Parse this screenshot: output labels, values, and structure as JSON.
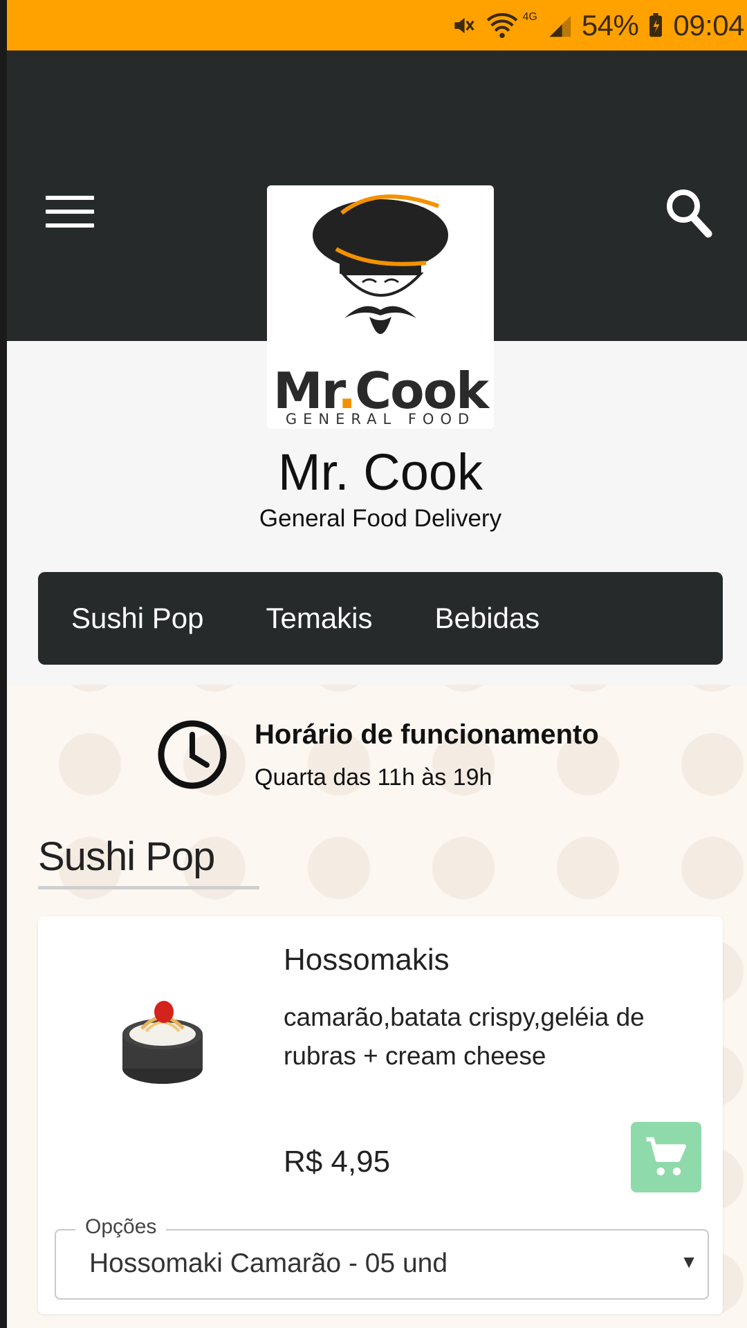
{
  "status_bar": {
    "network": "4G",
    "battery": "54%",
    "time": "09:04"
  },
  "header": {
    "menu_icon": "hamburger-menu-icon",
    "search_icon": "search-icon",
    "logo": {
      "wordmark_main": "Mr",
      "wordmark_dot": ".",
      "wordmark_rest": "Cook",
      "wordmark_sub": "GENERAL FOOD"
    }
  },
  "store": {
    "name": "Mr. Cook",
    "subtitle": "General Food Delivery"
  },
  "categories": [
    {
      "label": "Sushi Pop"
    },
    {
      "label": "Temakis"
    },
    {
      "label": "Bebidas"
    }
  ],
  "hours": {
    "icon": "clock-icon",
    "title": "Horário de funcionamento",
    "text": "Quarta das 11h às 19h"
  },
  "section": {
    "title": "Sushi Pop"
  },
  "product": {
    "name": "Hossomakis",
    "description": "camarão,batata crispy,geléia de rubras + cream cheese",
    "price": "R$ 4,95",
    "cart_icon": "shopping-cart-icon",
    "options_label": "Opções",
    "options_value": "Hossomaki Camarão - 05 und",
    "caret": "▼"
  },
  "colors": {
    "status_bar": "#ffa200",
    "header": "#262a2b",
    "cart_button": "#8fdaaa",
    "logo_accent": "#f29200"
  }
}
